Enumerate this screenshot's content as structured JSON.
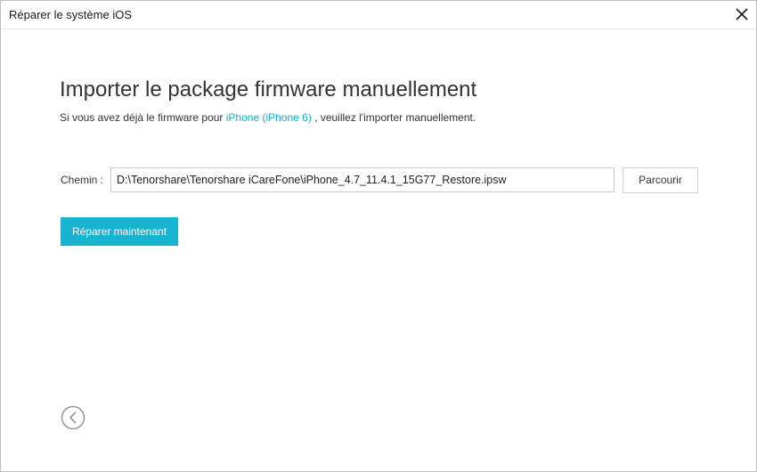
{
  "window": {
    "title": "Réparer le système iOS",
    "close_icon": "close-icon"
  },
  "main": {
    "heading": "Importer le package firmware manuellement",
    "subtext_before": "Si vous avez déjà le firmware pour ",
    "subtext_link": "iPhone (iPhone 6)",
    "subtext_after": " , veuillez l'importer manuellement.",
    "path_label": "Chemin :",
    "path_value": "D:\\Tenorshare\\Tenorshare iCareFone\\iPhone_4.7_11.4.1_15G77_Restore.ipsw",
    "browse_label": "Parcourir",
    "repair_label": "Réparer maintenant",
    "back_icon": "chevron-left-circle-icon"
  },
  "colors": {
    "accent": "#17b3cf",
    "link": "#17a9c8",
    "text": "#333333"
  }
}
